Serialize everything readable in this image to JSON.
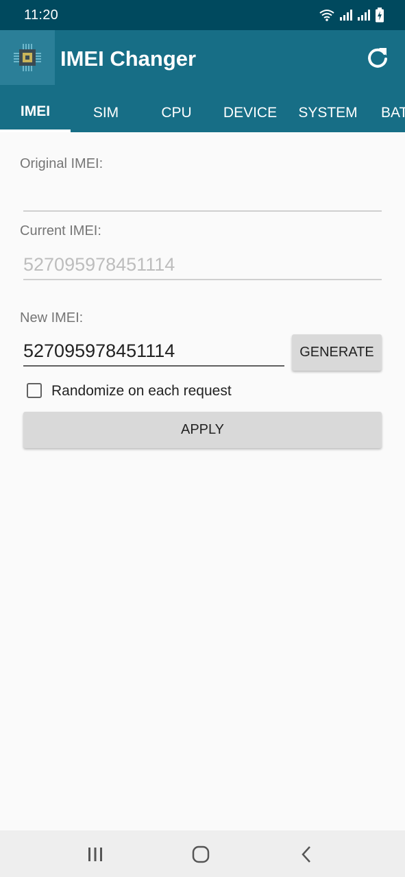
{
  "status_bar": {
    "time": "11:20"
  },
  "app_bar": {
    "title": "IMEI Changer",
    "icons": [
      "app-chip-icon",
      "refresh-icon"
    ],
    "colors": {
      "status_bar": "#00495e",
      "app_bar": "#176e86",
      "app_icon_bg": "#2b7f98"
    }
  },
  "tabs": [
    {
      "label": "IMEI",
      "active": true
    },
    {
      "label": "SIM",
      "active": false
    },
    {
      "label": "CPU",
      "active": false
    },
    {
      "label": "DEVICE",
      "active": false
    },
    {
      "label": "SYSTEM",
      "active": false
    },
    {
      "label": "BAT",
      "active": false
    }
  ],
  "form": {
    "original_label": "Original IMEI:",
    "original_value": "",
    "current_label": "Current IMEI:",
    "current_value": "527095978451114",
    "new_label": "New IMEI:",
    "new_value": "527095978451114",
    "generate_button": "GENERATE",
    "randomize_label": "Randomize on each request",
    "randomize_checked": false,
    "apply_button": "APPLY"
  },
  "nav_bar": {
    "icons": [
      "recents-icon",
      "home-icon",
      "back-icon"
    ]
  }
}
